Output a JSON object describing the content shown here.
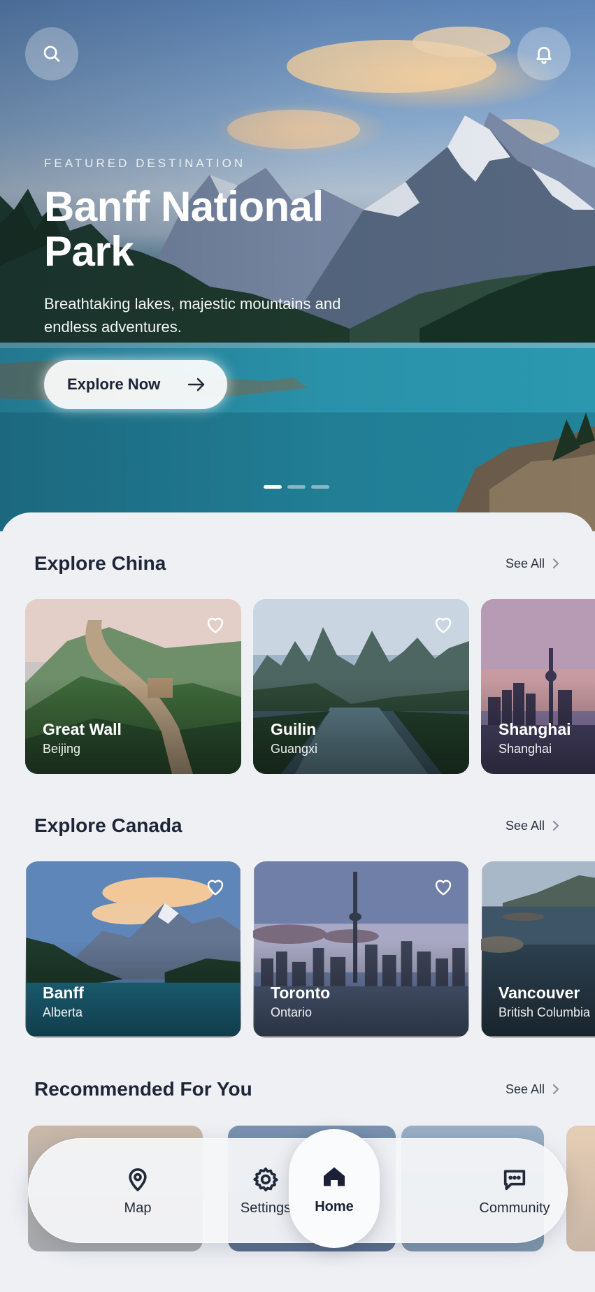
{
  "hero": {
    "eyebrow": "FEATURED DESTINATION",
    "title": "Banff National Park",
    "description": "Breathtaking lakes, majestic mountains and endless adventures.",
    "cta_label": "Explore Now",
    "slides": {
      "count": 3,
      "active_index": 0
    }
  },
  "sections": [
    {
      "title": "Explore China",
      "see_all": "See All",
      "cards": [
        {
          "name": "Great Wall",
          "region": "Beijing"
        },
        {
          "name": "Guilin",
          "region": "Guangxi"
        },
        {
          "name": "Shanghai",
          "region": "Shanghai"
        }
      ]
    },
    {
      "title": "Explore Canada",
      "see_all": "See All",
      "cards": [
        {
          "name": "Banff",
          "region": "Alberta"
        },
        {
          "name": "Toronto",
          "region": "Ontario"
        },
        {
          "name": "Vancouver",
          "region": "British Columbia"
        }
      ]
    },
    {
      "title": "Recommended For You",
      "see_all": "See All"
    }
  ],
  "nav": {
    "items": [
      {
        "label": "Map",
        "icon": "map-pin-icon"
      },
      {
        "label": "Settings",
        "icon": "gear-icon"
      },
      {
        "label": "Home",
        "icon": "home-icon",
        "active": true
      },
      {
        "label": "Community",
        "icon": "chat-bubble-icon"
      }
    ]
  },
  "colors": {
    "background": "#eef0f4",
    "text_primary": "#1d2436",
    "lake": "#2f9fb7"
  }
}
